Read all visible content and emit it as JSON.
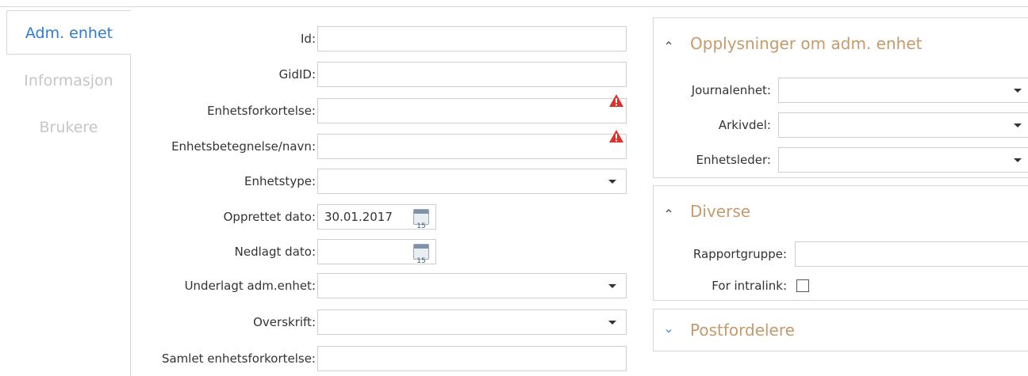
{
  "tabs": [
    {
      "label": "Adm. enhet",
      "active": true
    },
    {
      "label": "Informasjon",
      "active": false
    },
    {
      "label": "Brukere",
      "active": false
    }
  ],
  "form": {
    "id_label": "Id:",
    "id_value": "",
    "gidid_label": "GidID:",
    "gidid_value": "",
    "enhetsforkortelse_label": "Enhetsforkortelse:",
    "enhetsforkortelse_value": "",
    "enhetsbetegnelse_label": "Enhetsbetegnelse/navn:",
    "enhetsbetegnelse_value": "",
    "enhetstype_label": "Enhetstype:",
    "enhetstype_value": "",
    "opprettet_label": "Opprettet dato:",
    "opprettet_value": "30.01.2017",
    "nedlagt_label": "Nedlagt dato:",
    "nedlagt_value": "",
    "underlagt_label": "Underlagt adm.enhet:",
    "underlagt_value": "",
    "overskrift_label": "Overskrift:",
    "overskrift_value": "",
    "samlet_label": "Samlet enhetsforkortelse:",
    "samlet_value": "",
    "calendar_day": "15"
  },
  "panels": {
    "opplysninger": {
      "title": "Opplysninger om adm. enhet",
      "expanded": true,
      "journalenhet_label": "Journalenhet:",
      "arkivdel_label": "Arkivdel:",
      "enhetsleder_label": "Enhetsleder:"
    },
    "diverse": {
      "title": "Diverse",
      "expanded": true,
      "rapportgruppe_label": "Rapportgruppe:",
      "intralink_label": "For intralink:",
      "intralink_checked": false
    },
    "postfordelere": {
      "title": "Postfordelere",
      "expanded": false
    }
  },
  "colors": {
    "accent": "#2e7bd1",
    "panel_title": "#c79a6b",
    "warning": "#d9332b",
    "inactive_tab": "#c6c6c6"
  }
}
